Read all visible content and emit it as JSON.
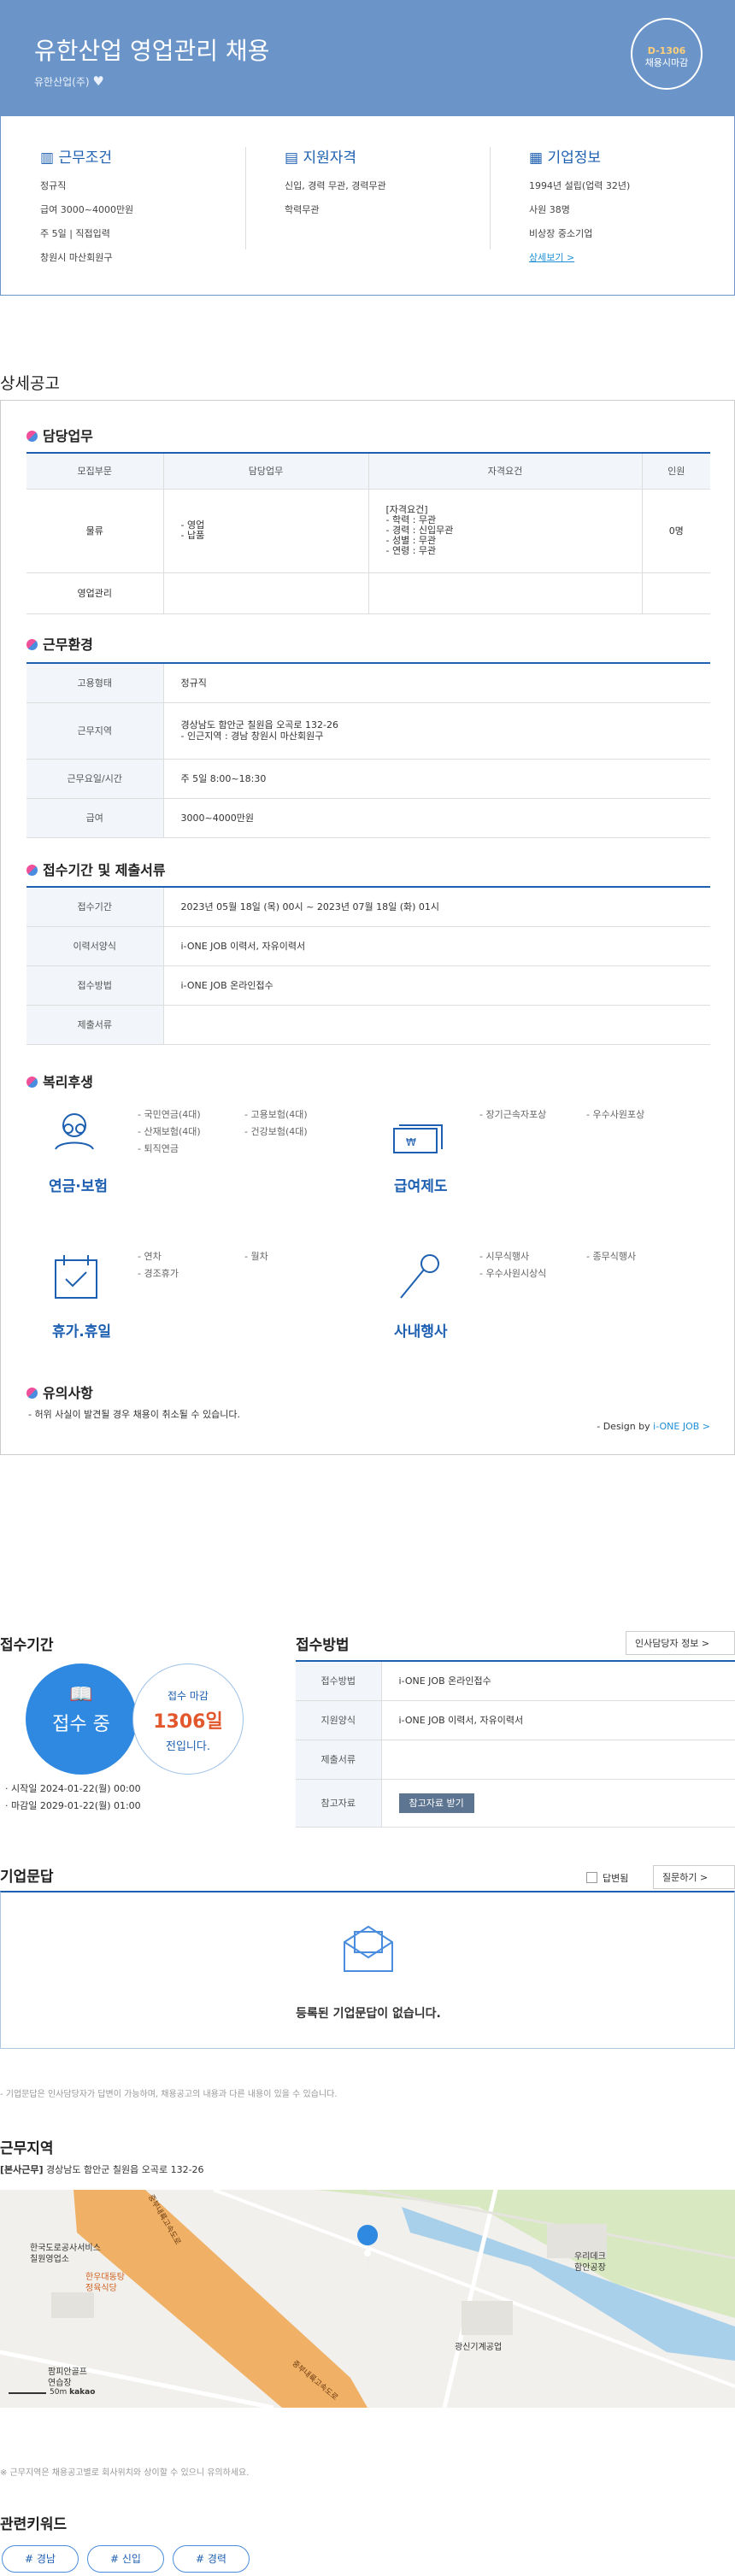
{
  "hero": {
    "title": "유한산업 영업관리 채용",
    "company": "유한산업(주)",
    "dday": "D-1306",
    "dday_sub": "채용시마감"
  },
  "summary": {
    "conditions": {
      "title": "근무조건",
      "items": [
        "정규직",
        "급여 3000~4000만원",
        "주 5일 | 직접입력",
        "창원시 마산회원구"
      ]
    },
    "qualifications": {
      "title": "지원자격",
      "items": [
        "신입, 경력 무관, 경력무관",
        "학력무관"
      ]
    },
    "company": {
      "title": "기업정보",
      "items": [
        "1994년 설립(업력 32년)",
        "사원 38명",
        "비상장 중소기업"
      ],
      "link": "상세보기 >"
    }
  },
  "detail": {
    "title": "상세공고",
    "duty": {
      "title": "담당업무",
      "headers": [
        "모집부문",
        "담당업무",
        "자격요건",
        "인원"
      ],
      "rows": [
        {
          "dept": "물류",
          "duty": "- 영업\n- 납품",
          "req": "[자격요건]\n- 학력 : 무관\n- 경력 : 신입무관\n- 성별 : 무관\n- 연령 : 무관",
          "count": "0명"
        },
        {
          "dept": "영업관리",
          "duty": "",
          "req": "",
          "count": ""
        }
      ]
    },
    "env": {
      "title": "근무환경",
      "rows": [
        {
          "k": "고용형태",
          "v": "정규직"
        },
        {
          "k": "근무지역",
          "v": "경상남도 함안군 칠원읍 오곡로 132-26\n- 인근지역 : 경남 창원시 마산회원구"
        },
        {
          "k": "근무요일/시간",
          "v": "주 5일 8:00~18:30"
        },
        {
          "k": "급여",
          "v": "3000~4000만원"
        }
      ]
    },
    "period": {
      "title": "접수기간 및 제출서류",
      "rows": [
        {
          "k": "접수기간",
          "v": "2023년 05월 18일 (목) 00시 ~ 2023년 07월 18일 (화) 01시"
        },
        {
          "k": "이력서양식",
          "v": "i-ONE JOB 이력서, 자유이력서"
        },
        {
          "k": "접수방법",
          "v": "i-ONE JOB 온라인접수"
        },
        {
          "k": "제출서류",
          "v": ""
        }
      ]
    },
    "welfare": {
      "title": "복리후생",
      "groups": [
        {
          "label": "연금·보험",
          "items": [
            "- 국민연금(4대)",
            "- 고용보험(4대)",
            "- 산재보험(4대)",
            "- 건강보험(4대)",
            "- 퇴직연금"
          ]
        },
        {
          "label": "급여제도",
          "items": [
            "- 장기근속자포상",
            "- 우수사원포상"
          ]
        },
        {
          "label": "휴가.휴일",
          "items": [
            "- 연차",
            "- 월차",
            "- 경조휴가"
          ]
        },
        {
          "label": "사내행사",
          "items": [
            "- 시무식행사",
            "- 종무식행사",
            "- 우수사원시상식"
          ]
        }
      ]
    },
    "notice": {
      "title": "유의사항",
      "text": "- 허위 사실이 발견될 경우 채용이 취소될 수 있습니다.",
      "design_prefix": "- Design by ",
      "design_link": "i-ONE JOB >"
    }
  },
  "apply": {
    "period_title": "접수기간",
    "status": "접수 중",
    "deadline_label": "접수 마감",
    "days": "1306일",
    "days_sub": "전입니다.",
    "start": "· 시작일 2024-01-22(월) 00:00",
    "end": "· 마감일 2029-01-22(월) 01:00",
    "method_title": "접수방법",
    "contact_btn": "인사담당자 정보 >",
    "rows": [
      {
        "k": "접수방법",
        "v": "i-ONE JOB 온라인접수"
      },
      {
        "k": "지원양식",
        "v": "i-ONE JOB 이력서, 자유이력서"
      },
      {
        "k": "제출서류",
        "v": ""
      },
      {
        "k": "참고자료",
        "v": ""
      }
    ],
    "ref_btn": "참고자료 받기"
  },
  "qna": {
    "title": "기업문답",
    "answered": "답변됨",
    "ask_btn": "질문하기 >",
    "empty": "등록된 기업문답이 없습니다.",
    "note": "- 기업문답은 인사담당자가 답변이 가능하며, 채용공고의 내용과 다른 내용이 있을 수 있습니다."
  },
  "location": {
    "title": "근무지역",
    "prefix": "[본사근무]",
    "address": "경상남도 함안군 칠원읍 오곡로 132-26",
    "note": "※ 근무지역은 채용공고별로 회사위치와 상이할 수 있으니 유의하세요.",
    "map_labels": {
      "a": "한국도로공사서비스",
      "a2": "칠원영업소",
      "b": "한우대동탕",
      "b2": "정육식당",
      "c": "팜피안골프",
      "c2": "연습장",
      "d": "우리데크",
      "d2": "함안공장",
      "e": "광신기계공업",
      "road": "중부내륙고속도로",
      "road2": "중부내륙고속도로",
      "scale": "50m",
      "brand": "kakao"
    }
  },
  "keywords": {
    "title": "관련키워드",
    "items": [
      "# 경남",
      "# 신입",
      "# 경력"
    ]
  }
}
